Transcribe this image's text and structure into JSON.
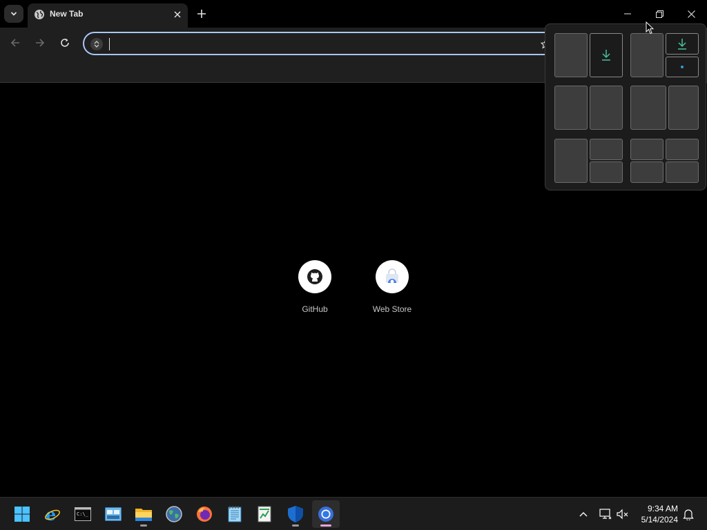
{
  "browser": {
    "tab": {
      "title": "New Tab",
      "favicon": "globe-icon"
    },
    "controls": [
      "tab-search-icon",
      "new-tab-icon",
      "minimize-icon",
      "restore-icon",
      "close-icon"
    ],
    "omnibox": {
      "value": "",
      "icon": "site-info-icon"
    }
  },
  "snap_layouts": {
    "layouts": [
      "half-half",
      "half-quarter-quarter",
      "half-half",
      "wide-narrow",
      "half-quarter-quarter",
      "quarters"
    ],
    "highlight_color": "#47c2a0"
  },
  "new_tab_page": {
    "shortcuts": [
      {
        "label": "GitHub",
        "icon": "github-icon"
      },
      {
        "label": "Web Store",
        "icon": "web-store-icon"
      }
    ]
  },
  "taskbar": {
    "apps": [
      {
        "name": "start-button",
        "icon": "windows-logo-icon"
      },
      {
        "name": "internet-explorer",
        "icon": "ie-icon"
      },
      {
        "name": "command-prompt",
        "icon": "terminal-icon"
      },
      {
        "name": "control-panel",
        "icon": "control-panel-icon"
      },
      {
        "name": "file-explorer",
        "icon": "folder-icon"
      },
      {
        "name": "app-globe",
        "icon": "globe-app-icon"
      },
      {
        "name": "firefox",
        "icon": "firefox-icon"
      },
      {
        "name": "notepad",
        "icon": "notepad-icon"
      },
      {
        "name": "spreadsheet",
        "icon": "spreadsheet-icon"
      },
      {
        "name": "security",
        "icon": "shield-icon"
      },
      {
        "name": "chrome",
        "icon": "chrome-icon"
      }
    ],
    "clock": {
      "time": "9:34 AM",
      "date": "5/14/2024"
    }
  }
}
